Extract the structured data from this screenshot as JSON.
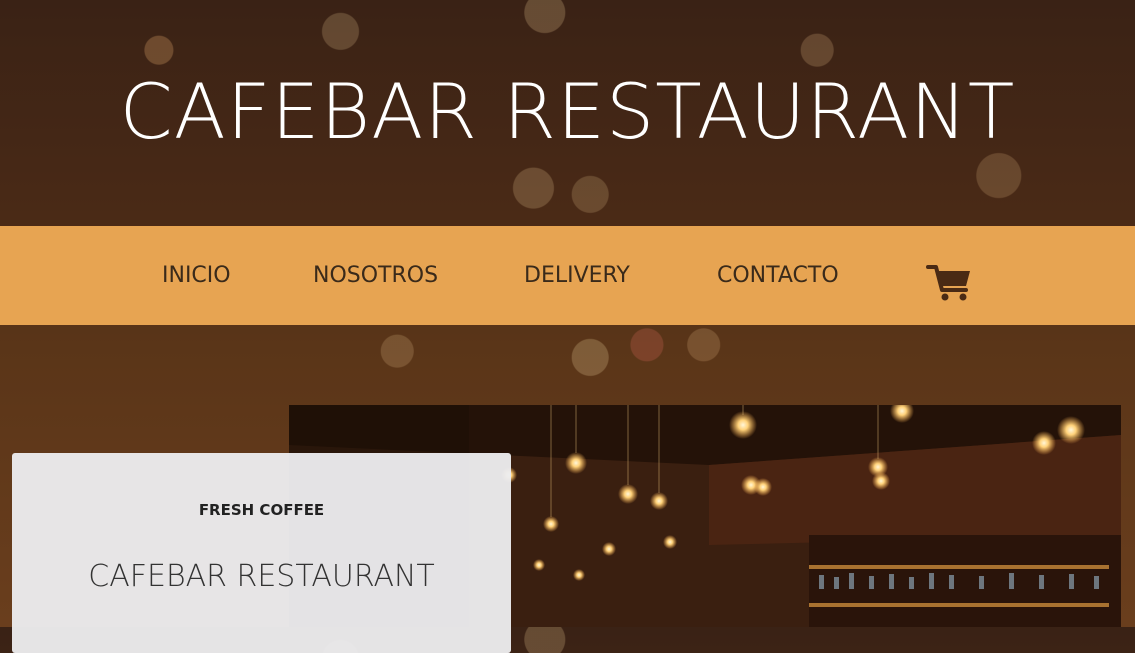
{
  "header": {
    "title": "CAFEBAR RESTAURANT"
  },
  "nav": {
    "items": [
      {
        "label": "INICIO"
      },
      {
        "label": "NOSOTROS"
      },
      {
        "label": "DELIVERY"
      },
      {
        "label": "CONTACTO"
      }
    ],
    "cart_icon": "shopping-cart-icon",
    "background_color": "#e7a452"
  },
  "intro_card": {
    "eyebrow": "FRESH COFFEE",
    "title": "CAFEBAR RESTAURANT"
  },
  "colors": {
    "accent": "#e7a452",
    "text_dark": "#3a2a1a"
  }
}
